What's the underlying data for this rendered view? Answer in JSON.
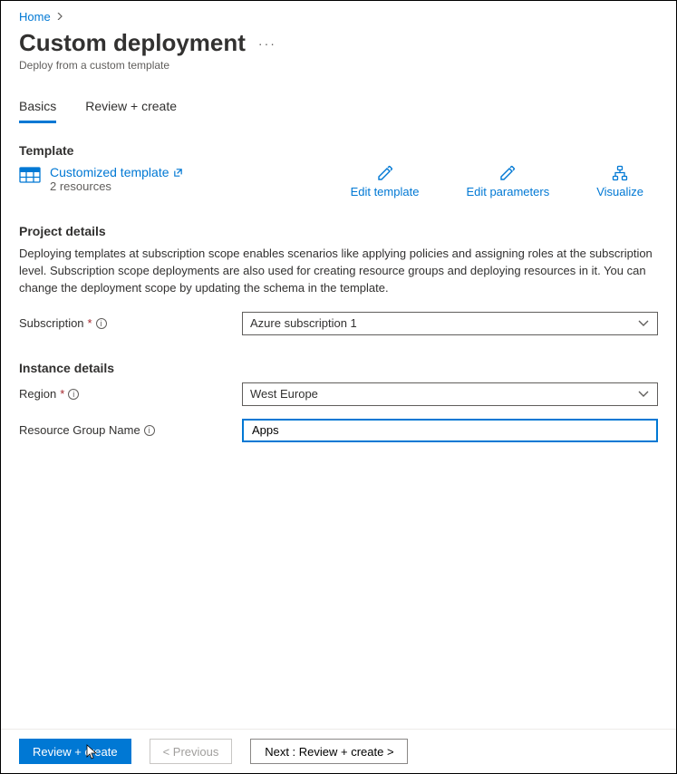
{
  "breadcrumb": {
    "home": "Home"
  },
  "title": "Custom deployment",
  "subtitle": "Deploy from a custom template",
  "tabs": {
    "basics": "Basics",
    "review": "Review + create"
  },
  "sections": {
    "template": "Template",
    "project": "Project details",
    "instance": "Instance details"
  },
  "template": {
    "link": "Customized template",
    "resources": "2 resources",
    "edit_template": "Edit template",
    "edit_parameters": "Edit parameters",
    "visualize": "Visualize"
  },
  "project_desc": "Deploying templates at subscription scope enables scenarios like applying policies and assigning roles at the subscription level. Subscription scope deployments are also used for creating resource groups and deploying resources in it. You can change the deployment scope by updating the schema in the template.",
  "fields": {
    "subscription_label": "Subscription",
    "subscription_value": "Azure subscription 1",
    "region_label": "Region",
    "region_value": "West Europe",
    "rg_label": "Resource Group Name",
    "rg_value": "Apps"
  },
  "footer": {
    "review": "Review + create",
    "previous": "< Previous",
    "next": "Next : Review + create >"
  }
}
